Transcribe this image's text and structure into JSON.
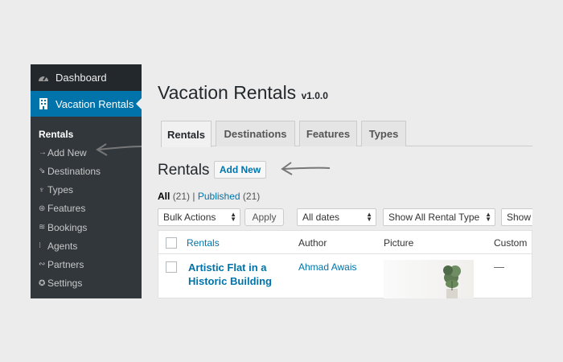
{
  "sidebar": {
    "dashboard": "Dashboard",
    "plugin": "Vacation Rentals",
    "items": [
      {
        "label": "Rentals",
        "glyph": ""
      },
      {
        "label": "Add New",
        "glyph": "→"
      },
      {
        "label": "Destinations",
        "glyph": "⇘"
      },
      {
        "label": "Types",
        "glyph": "♆"
      },
      {
        "label": "Features",
        "glyph": "⊛"
      },
      {
        "label": "Bookings",
        "glyph": "≋"
      },
      {
        "label": "Agents",
        "glyph": "⁝"
      },
      {
        "label": "Partners",
        "glyph": "∾"
      },
      {
        "label": "Settings",
        "glyph": "✪"
      }
    ]
  },
  "page": {
    "title": "Vacation Rentals",
    "version": "v1.0.0",
    "tabs": [
      "Rentals",
      "Destinations",
      "Features",
      "Types"
    ],
    "section_title": "Rentals",
    "add_new": "Add New",
    "views": {
      "all": "All",
      "all_count": "(21)",
      "sep": "|",
      "published": "Published",
      "published_count": "(21)"
    }
  },
  "filters": {
    "bulk_actions": "Bulk Actions",
    "apply": "Apply",
    "dates": "All dates",
    "rental_type": "Show All Rental Type",
    "more": "Show"
  },
  "table": {
    "columns": [
      "Rentals",
      "Author",
      "Picture",
      "Custom"
    ],
    "rows": [
      {
        "title": "Artistic Flat in a Historic Building",
        "author": "Ahmad Awais",
        "custom": "—"
      }
    ]
  },
  "icons": {
    "dashboard": "dashboard-icon",
    "plugin": "building-icon",
    "arrow": "hand-drawn-arrow-icon"
  },
  "colors": {
    "admin_bar": "#23282d",
    "accent": "#0073aa",
    "link": "#0073aa"
  }
}
